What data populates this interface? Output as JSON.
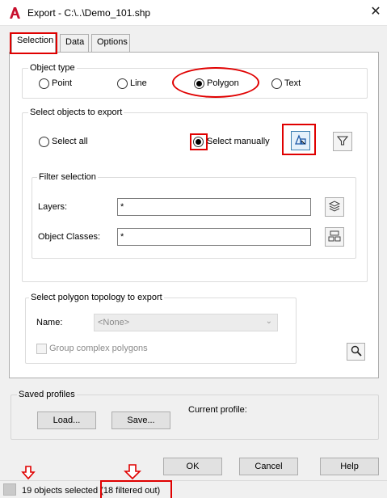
{
  "window": {
    "title": "Export - C:\\..\\Demo_101.shp",
    "close_glyph": "✕"
  },
  "tabs": [
    {
      "label": "Selection",
      "active": true
    },
    {
      "label": "Data",
      "active": false
    },
    {
      "label": "Options",
      "active": false
    }
  ],
  "object_type": {
    "title": "Object type",
    "options": [
      {
        "label": "Point",
        "selected": false
      },
      {
        "label": "Line",
        "selected": false
      },
      {
        "label": "Polygon",
        "selected": true
      },
      {
        "label": "Text",
        "selected": false
      }
    ]
  },
  "select_objects": {
    "title": "Select objects to export",
    "select_all_label": "Select all",
    "select_manually_label": "Select manually",
    "selected": "Select manually",
    "filter": {
      "title": "Filter selection",
      "layers_label": "Layers:",
      "layers_value": "*",
      "classes_label": "Object Classes:",
      "classes_value": "*"
    }
  },
  "topology": {
    "title": "Select polygon topology to export",
    "name_label": "Name:",
    "name_value": "<None>",
    "group_complex_label": "Group complex polygons"
  },
  "saved_profiles": {
    "title": "Saved profiles",
    "load_label": "Load...",
    "save_label": "Save...",
    "current_profile_label": "Current profile:"
  },
  "footer": {
    "ok_label": "OK",
    "cancel_label": "Cancel",
    "help_label": "Help"
  },
  "status": {
    "text": "19 objects selected (18 filtered out)"
  },
  "colors": {
    "annotation_red": "#e00000",
    "autocad_red": "#c8102e"
  },
  "icons": {
    "app": "autocad-logo-icon",
    "select_objects": "select-objects-icon",
    "quick_filter": "funnel-filter-icon",
    "layers": "layers-stack-icon",
    "object_classes": "object-classes-icon",
    "zoom": "magnifier-icon"
  }
}
